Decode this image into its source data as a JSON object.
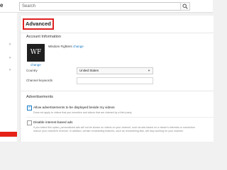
{
  "topbar": {
    "logo_fragment": "e",
    "search_placeholder": "Search"
  },
  "sidebar": {
    "chevrons": [
      "›",
      "›",
      "›"
    ]
  },
  "panel": {
    "heading": "Advanced",
    "account_info": {
      "title": "Account Information",
      "avatar_initials": "WF",
      "channel_name": "Wisdom Fighters",
      "change_inline": "change",
      "change_below": "change",
      "country_label": "Country",
      "country_value": "United States",
      "keywords_label": "Channel keywords",
      "keywords_value": ""
    },
    "advertisements": {
      "title": "Advertisements",
      "allow_ads_label": "Allow advertisements to be displayed beside my videos",
      "allow_ads_desc": "Does not apply to videos that you monetize and videos that are claimed by a third party.",
      "allow_ads_checked": true,
      "disable_interest_label": "Disable interest-based ads",
      "disable_interest_desc_1": "If you select this option, personalized ads will not be shown on videos on your channel, such as ads based on a viewer's interests or connection",
      "disable_interest_desc_2": "reduce your channel's revenue. In addition, certain remarketing features, such as remarketing lists, will stop working for your channel.",
      "disable_interest_checked": false
    }
  }
}
